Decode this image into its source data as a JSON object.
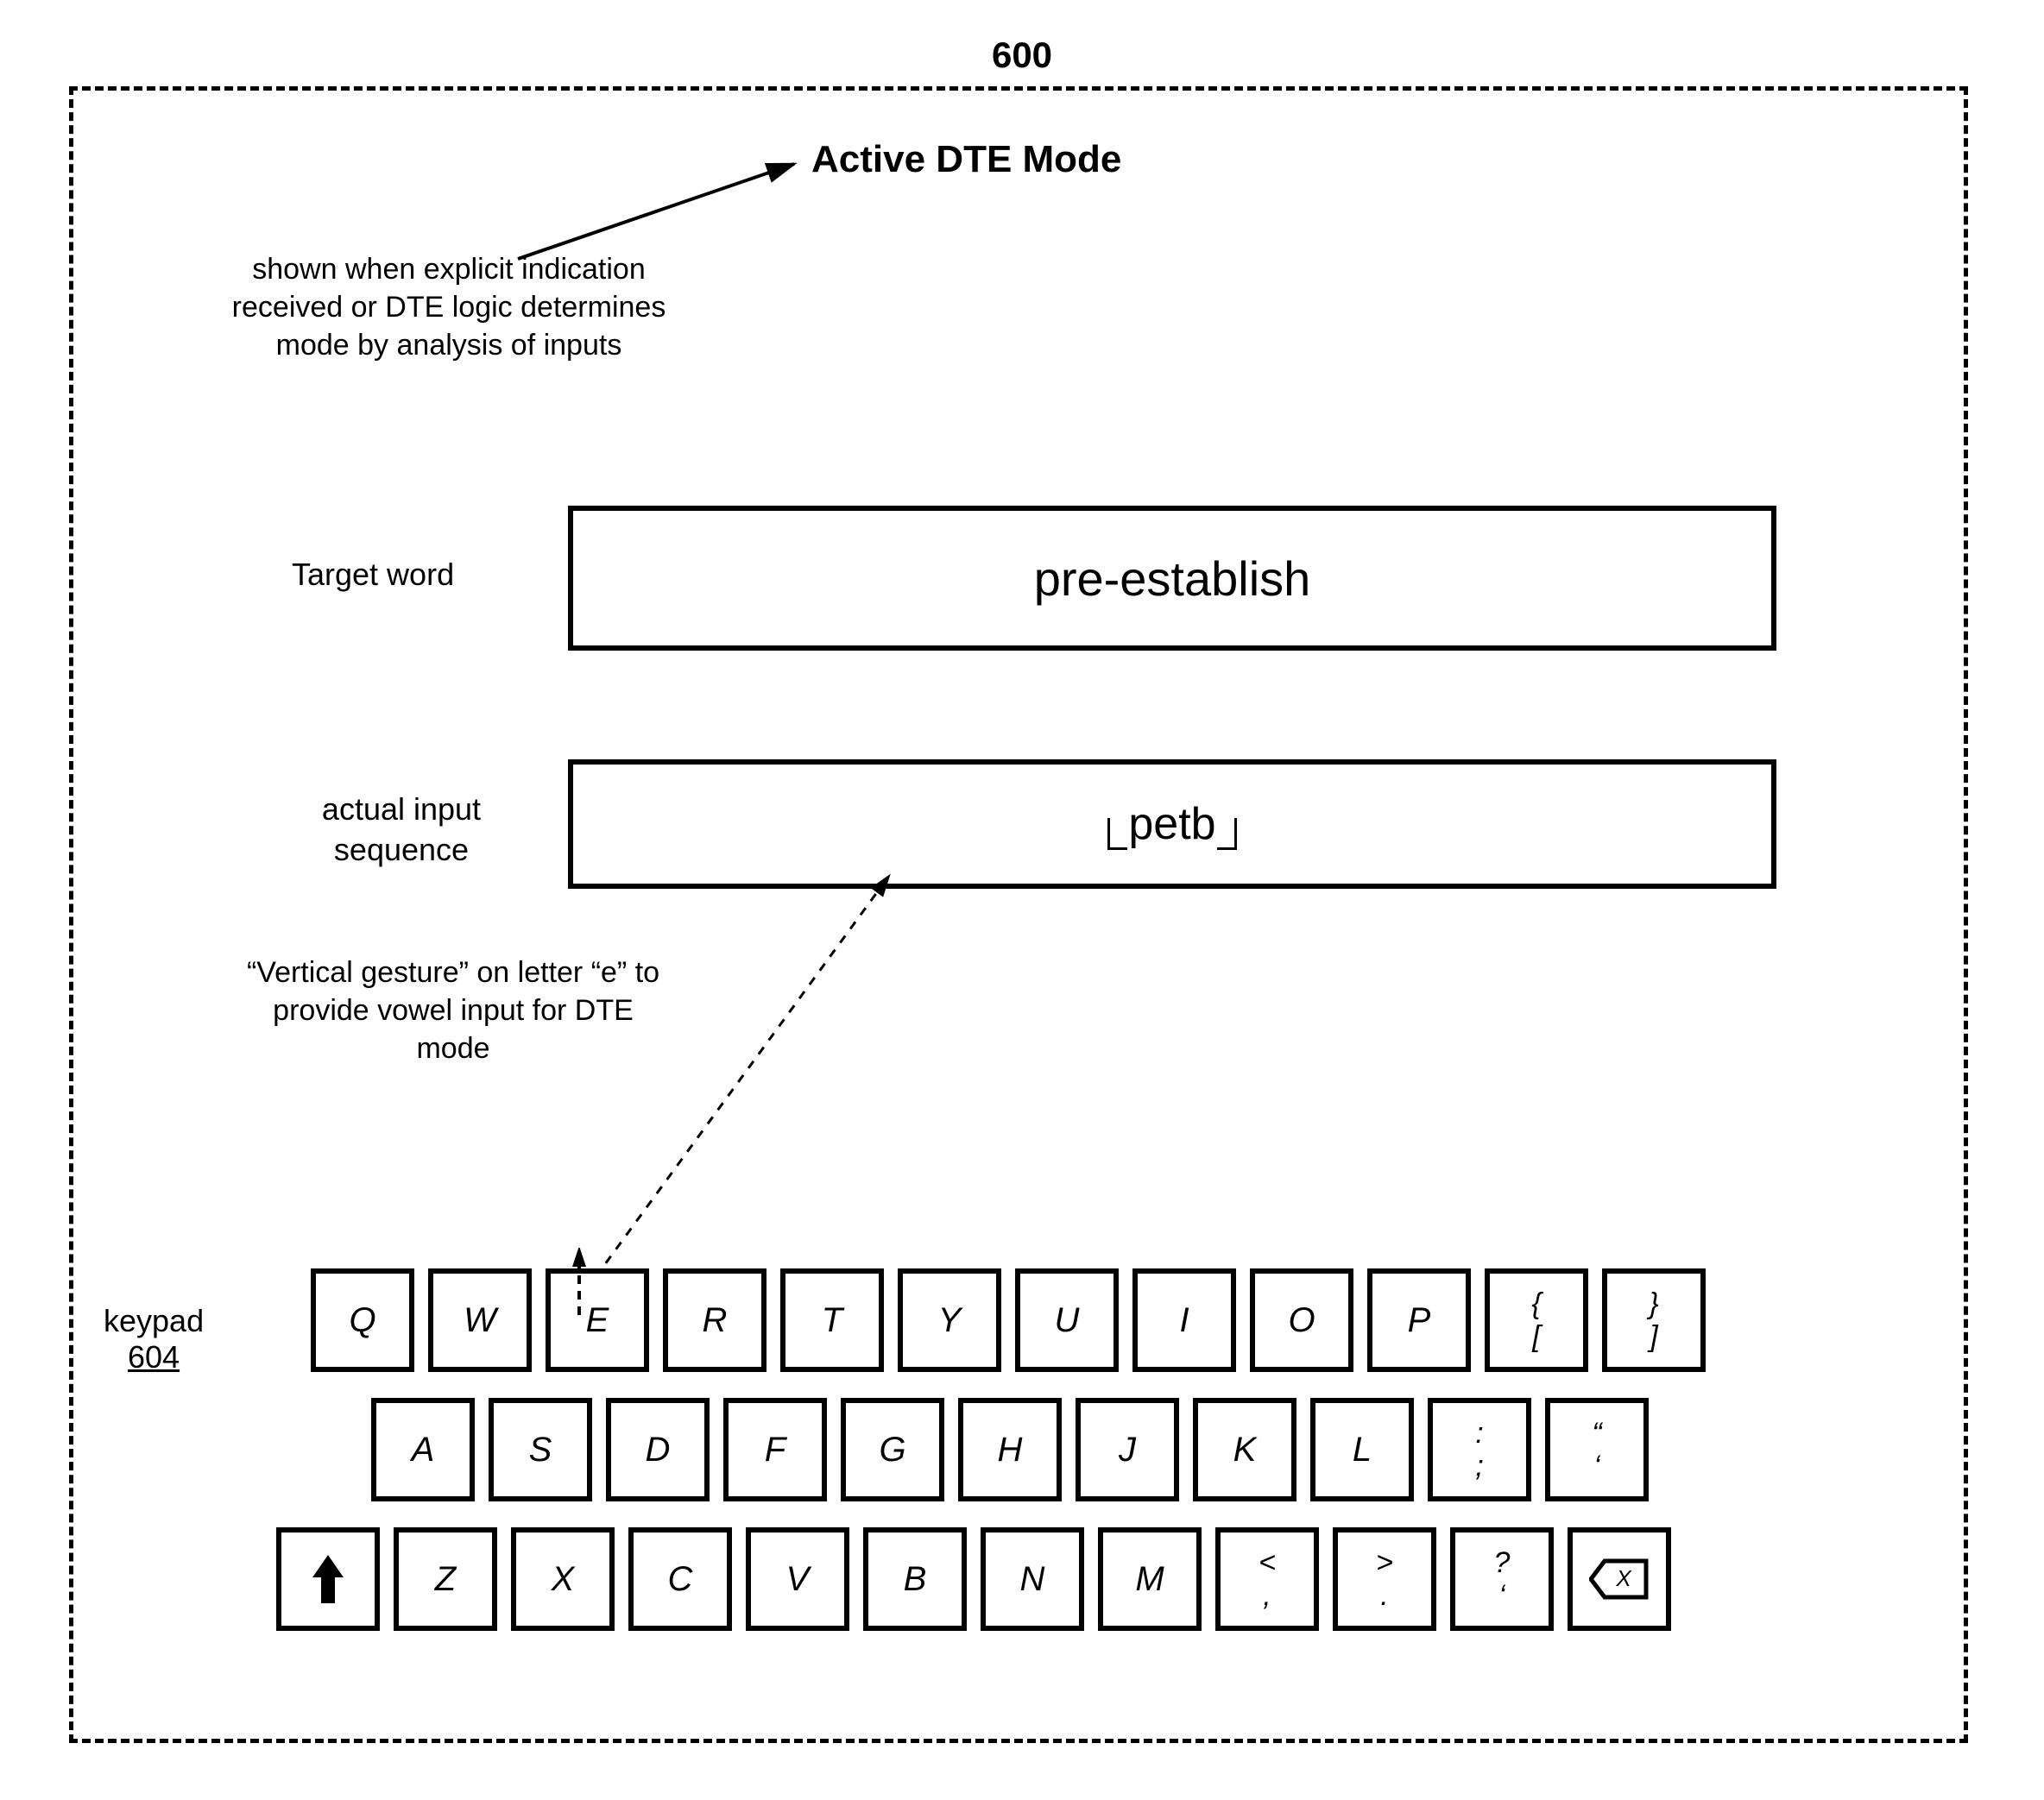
{
  "figure_number": "600",
  "title": "Active DTE Mode",
  "note_explicit": "shown when explicit indication received or DTE logic determines mode by analysis of inputs",
  "label_target": "Target word",
  "target_word": "pre-establish",
  "label_input": "actual input sequence",
  "input_sequence": "petb",
  "note_gesture": "“Vertical gesture” on letter “e” to provide vowel input for DTE mode",
  "keypad_label": "keypad",
  "keypad_ref": "604",
  "keys": {
    "row1": [
      "Q",
      "W",
      "E",
      "R",
      "T",
      "Y",
      "U",
      "I",
      "O",
      "P"
    ],
    "row1_brackets": [
      {
        "top": "{",
        "bot": "["
      },
      {
        "top": "}",
        "bot": "]"
      }
    ],
    "row2": [
      "A",
      "S",
      "D",
      "F",
      "G",
      "H",
      "J",
      "K",
      "L"
    ],
    "row2_punct": [
      {
        "top": ":",
        "bot": ";"
      },
      {
        "top": "“",
        "bot": "‘"
      }
    ],
    "row3": [
      "Z",
      "X",
      "C",
      "V",
      "B",
      "N",
      "M"
    ],
    "row3_punct": [
      {
        "top": "<",
        "bot": ","
      },
      {
        "top": ">",
        "bot": "."
      },
      {
        "top": "?",
        "bot": "‘"
      }
    ],
    "backspace_glyph": "X"
  }
}
